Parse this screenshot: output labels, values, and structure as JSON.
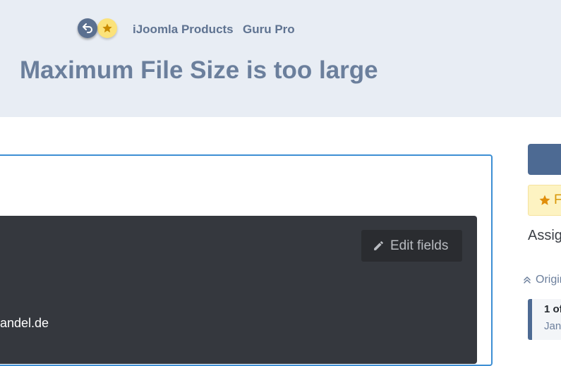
{
  "header": {
    "breadcrumbs": [
      "iJoomla Products",
      "Guru Pro"
    ],
    "title": "Maximum File Size is too large",
    "icons": {
      "back": "back-arrow-icon",
      "favorite": "star-icon"
    }
  },
  "editor": {
    "edit_fields_label": "Edit fields",
    "partial_text": "andel.de"
  },
  "sidebar": {
    "favorite_partial": "F",
    "assign_partial": "Assig",
    "original_partial": "Origin",
    "card_line1": "1 of",
    "card_line2": "Jan"
  },
  "colors": {
    "header_bg": "#e8edf4",
    "accent": "#4d6a93",
    "editor_border": "#3d8fd4",
    "dark_panel": "#35383e",
    "favorite_bg": "#fdf3c2"
  }
}
